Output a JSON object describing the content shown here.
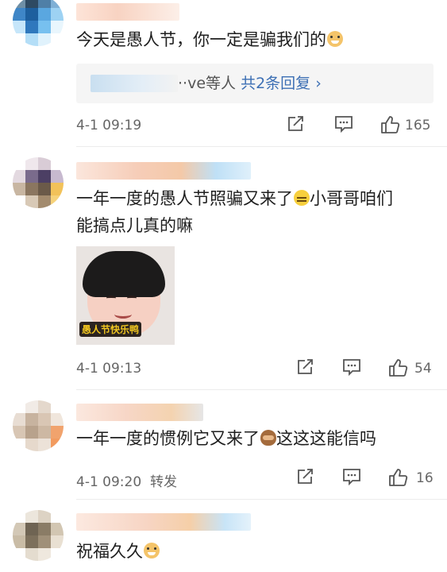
{
  "comments": [
    {
      "text": "今天是愚人节，你一定是骗我们的",
      "emoji": "doge-emoji",
      "reply_suffix": "··ve等人",
      "reply_link": "共2条回复 ›",
      "time": "4-1 09:19",
      "like_count": "165"
    },
    {
      "text_line1": "一年一度的愚人节照骗又来了",
      "emoji": "sweat-emoji",
      "text_line1_tail": "小哥哥咱们",
      "text_line2": "能搞点儿真的嘛",
      "sticker_caption": "愚人节快乐鸭",
      "time": "4-1 09:13",
      "like_count": "54"
    },
    {
      "text": "一年一度的惯例它又来了",
      "emoji": "see-no-evil-monkey-emoji",
      "text_tail": "这这这能信吗",
      "time": "4-1 09:20",
      "forward_label": "转发",
      "like_count": "16"
    },
    {
      "text": "祝福久久",
      "emoji": "doge-emoji"
    }
  ],
  "colors": {
    "link": "#3c6fb4",
    "meta_text": "#666666",
    "reply_bg": "#f5f5f5"
  }
}
